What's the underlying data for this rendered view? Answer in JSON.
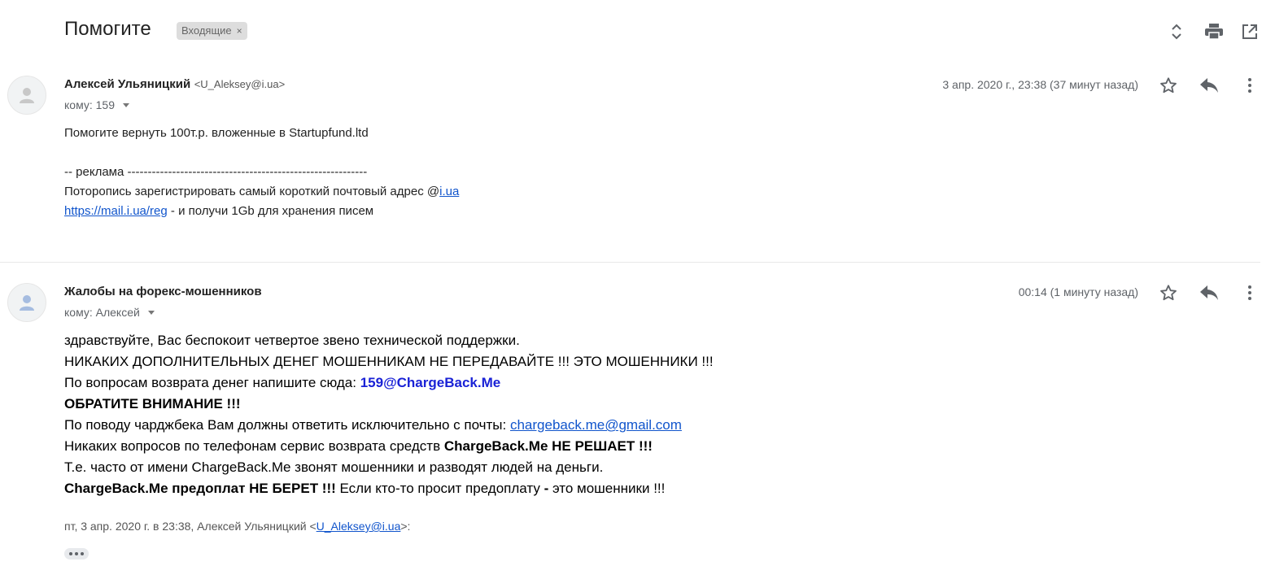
{
  "thread": {
    "subject": "Помогите",
    "label": "Входящие",
    "label_remove": "×"
  },
  "toolbar_icons": [
    "expand-collapse-icon",
    "print-icon",
    "open-in-new-window-icon"
  ],
  "messages": [
    {
      "sender_name": "Алексей Ульяницкий",
      "sender_email": "<U_Aleksey@i.ua>",
      "to": "кому: 159",
      "date": "3 апр. 2020 г., 23:38 (37 минут назад)",
      "body_line1": "Помогите вернуть 100т.р. вложенные в Startupfund.ltd",
      "ad_line1": "-- реклама -----------------------------------------------------------",
      "ad_line2_prefix": "Потoропись зарегистрировать самый короткий почтовый адрес @",
      "ad_line2_link": "i.ua",
      "ad_line3_link": "https://mail.i.ua/reg",
      "ad_line3_suffix": " - и получи 1Gb для хранения писем"
    },
    {
      "sender_name": "Жалобы на форекс-мошенников",
      "to": "кому: Алексей",
      "date": "00:14 (1 минуту назад)",
      "line1": "здравствуйте, Вас беспокоит четвертое звено технической поддержки.",
      "line2": "НИКАКИХ ДОПОЛНИТЕЛЬНЫХ ДЕНЕГ МОШЕННИКАМ НЕ ПЕРЕДАВАЙТЕ !!! ЭТО МОШЕННИКИ !!!",
      "line3_prefix": "По вопросам возврата денег напишите сюда: ",
      "line3_email": "159@ChargeBack.Me",
      "line4": "ОБРАТИТЕ ВНИМАНИЕ !!!",
      "line5_prefix": "По поводу чарджбека Вам должны ответить исключительно с почты: ",
      "line5_link": "chargeback.me@gmail.com",
      "line6_prefix": "Никаких вопросов по телефонам сервис возврата средств ",
      "line6_bold": "ChargeBack.Me НЕ РЕШАЕТ !!!",
      "line7": "Т.е. часто от имени ChargeBack.Me звонят мошенники и разводят людей на деньги.",
      "line8_bold": "ChargeBack.Me предоплат НЕ БЕРЕТ !!!",
      "line8_mid": " Если кто-то просит предоплату ",
      "line8_dash": "-",
      "line8_end": " это мошенники !!!",
      "quote_prefix": "пт, 3 апр. 2020 г. в 23:38, Алексей Ульяницкий <",
      "quote_link": "U_Aleksey@i.ua",
      "quote_suffix": ">:"
    }
  ],
  "colors": {
    "link": "#1155cc",
    "accent_email": "#1a22d6",
    "label_bg": "#dddddd"
  }
}
